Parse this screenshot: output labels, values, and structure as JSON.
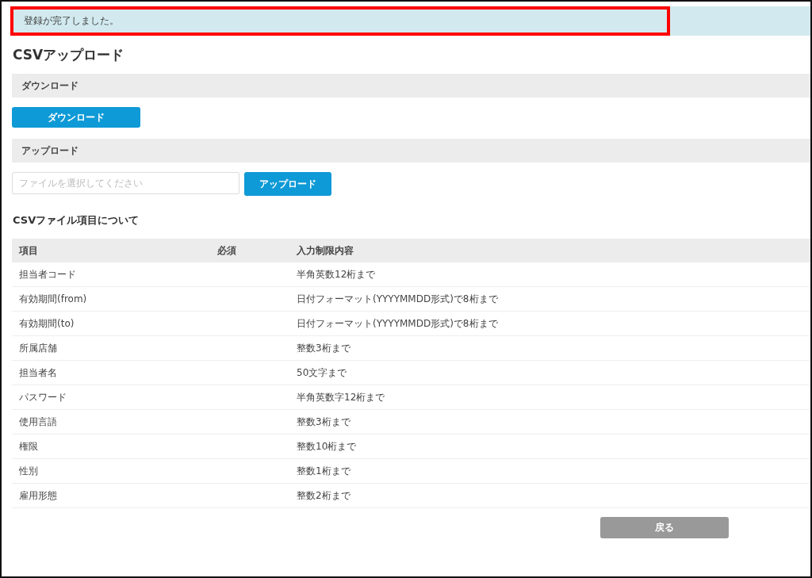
{
  "alert": {
    "message": "登録が完了しました。",
    "highlighted": true
  },
  "title": "CSVアップロード",
  "download_section": {
    "heading": "ダウンロード",
    "button": "ダウンロード"
  },
  "upload_section": {
    "heading": "アップロード",
    "file_field": {
      "placeholder": "ファイルを選択してください"
    },
    "button": "アップロード"
  },
  "fields_section": {
    "heading": "CSVファイル項目について",
    "columns": [
      "項目",
      "必須",
      "入力制限内容"
    ],
    "rows": [
      {
        "item": "担当者コード",
        "restriction": "半角英数12桁まで"
      },
      {
        "item": "有効期間(from)",
        "restriction": "日付フォーマット(YYYYMMDD形式)で8桁まで"
      },
      {
        "item": "有効期間(to)",
        "restriction": "日付フォーマット(YYYYMMDD形式)で8桁まで"
      },
      {
        "item": "所属店舗",
        "restriction": "整数3桁まで"
      },
      {
        "item": "担当者名",
        "restriction": "50文字まで"
      },
      {
        "item": "パスワード",
        "restriction": "半角英数字12桁まで"
      },
      {
        "item": "使用言語",
        "restriction": "整数3桁まで"
      },
      {
        "item": "権限",
        "restriction": "整数10桁まで"
      },
      {
        "item": "性別",
        "restriction": "整数1桁まで"
      },
      {
        "item": "雇用形態",
        "restriction": "整数2桁まで"
      }
    ]
  },
  "back_button": "戻る"
}
